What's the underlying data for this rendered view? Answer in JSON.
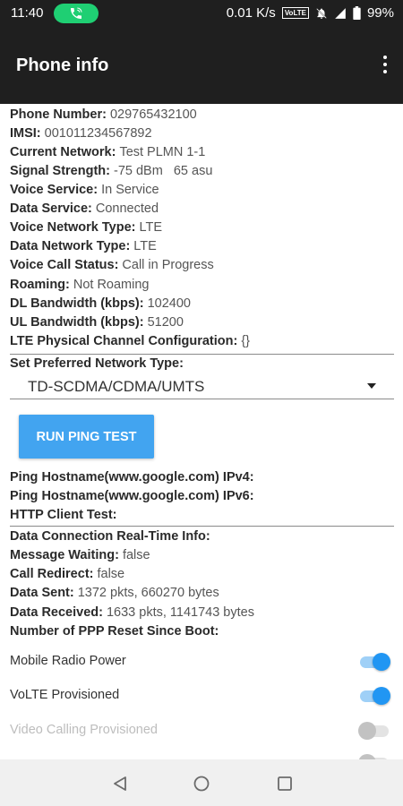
{
  "status_bar": {
    "time": "11:40",
    "network_speed": "0.01 K/s",
    "volte_badge": "VoLTE",
    "battery": "99%",
    "call_pill_color": "#1fcf73",
    "icons": [
      "phone-call-icon",
      "mute-icon",
      "signal-icon",
      "battery-icon"
    ]
  },
  "app_bar": {
    "title": "Phone info",
    "menu_icon": "more-vert-icon"
  },
  "info_rows": [
    {
      "label": "Phone Number:",
      "value": "029765432100"
    },
    {
      "label": "IMSI:",
      "value": "001011234567892"
    },
    {
      "label": "Current Network:",
      "value": "Test PLMN 1-1"
    },
    {
      "label": "Signal Strength:",
      "value": "-75 dBm   65 asu"
    },
    {
      "label": "Voice Service:",
      "value": "In Service"
    },
    {
      "label": "Data Service:",
      "value": "Connected"
    },
    {
      "label": "Voice Network Type:",
      "value": "LTE"
    },
    {
      "label": "Data Network Type:",
      "value": "LTE"
    },
    {
      "label": "Voice Call Status:",
      "value": "Call in Progress"
    },
    {
      "label": "Roaming:",
      "value": "Not Roaming"
    },
    {
      "label": "DL Bandwidth (kbps):",
      "value": "102400"
    },
    {
      "label": "UL Bandwidth (kbps):",
      "value": "51200"
    },
    {
      "label": "LTE Physical Channel Configuration:",
      "value": "{}"
    }
  ],
  "preferred_network": {
    "label": "Set Preferred Network Type:",
    "selected": "TD-SCDMA/CDMA/UMTS"
  },
  "ping_button": "RUN PING TEST",
  "ping_rows": [
    {
      "label": "Ping Hostname(www.google.com) IPv4:",
      "value": ""
    },
    {
      "label": "Ping Hostname(www.google.com) IPv6:",
      "value": ""
    },
    {
      "label": "HTTP Client Test:",
      "value": ""
    }
  ],
  "data_rows": [
    {
      "label": "Data Connection Real-Time Info:",
      "value": ""
    },
    {
      "label": "Message Waiting:",
      "value": "false"
    },
    {
      "label": "Call Redirect:",
      "value": "false"
    },
    {
      "label": "Data Sent:",
      "value": "1372 pkts, 660270 bytes"
    },
    {
      "label": "Data Received:",
      "value": "1633 pkts, 1141743 bytes"
    },
    {
      "label": "Number of PPP Reset Since Boot:",
      "value": ""
    }
  ],
  "switches": [
    {
      "label": "Mobile Radio Power",
      "on": true,
      "enabled": true
    },
    {
      "label": "VoLTE Provisioned",
      "on": true,
      "enabled": true
    },
    {
      "label": "Video Calling Provisioned",
      "on": false,
      "enabled": false
    }
  ],
  "accent_color": "#2196f3",
  "nav_bar": {
    "icons": [
      "back-icon",
      "home-icon",
      "recents-icon"
    ]
  }
}
